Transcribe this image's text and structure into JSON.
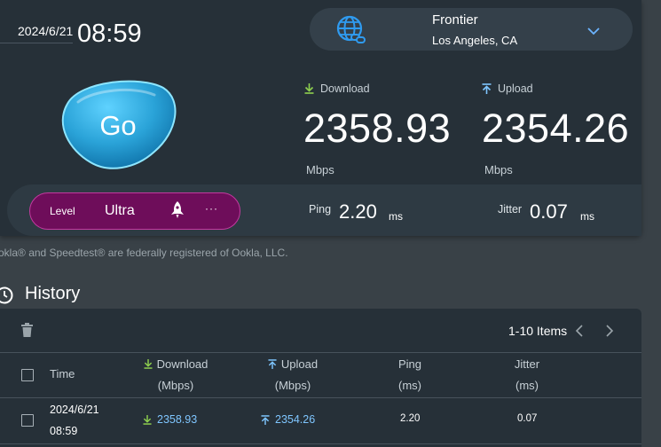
{
  "clock": {
    "date": "2024/6/21",
    "time": "08:59"
  },
  "server": {
    "isp": "Frontier",
    "location": "Los Angeles, CA"
  },
  "go_label": "Go",
  "download": {
    "label": "Download",
    "value": "2358.93",
    "unit": "Mbps"
  },
  "upload": {
    "label": "Upload",
    "value": "2354.26",
    "unit": "Mbps"
  },
  "level": {
    "label": "Level",
    "value": "Ultra",
    "more": "···"
  },
  "ping": {
    "label": "Ping",
    "value": "2.20",
    "unit": "ms"
  },
  "jitter": {
    "label": "Jitter",
    "value": "0.07",
    "unit": "ms"
  },
  "legal": "okla® and Speedtest® are federally registered of Ookla, LLC.",
  "history": {
    "title": "History",
    "pager_text": "1-10 Items",
    "columns": {
      "time": "Time",
      "download": "Download",
      "download_unit": "(Mbps)",
      "upload": "Upload",
      "upload_unit": "(Mbps)",
      "ping": "Ping",
      "ping_unit": "(ms)",
      "jitter": "Jitter",
      "jitter_unit": "(ms)"
    },
    "rows": [
      {
        "date": "2024/6/21",
        "time": "08:59",
        "download": "2358.93",
        "upload": "2354.26",
        "ping": "2.20",
        "jitter": "0.07"
      }
    ]
  },
  "colors": {
    "accent_link": "#7fc6ff",
    "level_bg": "#6e0d5a",
    "level_border": "#c23a9f",
    "go_button": "#2aa3d8",
    "download_arrow": "#8fd14f",
    "upload_arrow": "#7fc6ff"
  },
  "icons": [
    "globe-link-icon",
    "chevron-down-icon",
    "download-arrow-icon",
    "upload-arrow-icon",
    "rocket-icon",
    "history-clock-icon",
    "trash-icon",
    "chevron-left-icon",
    "chevron-right-icon"
  ]
}
